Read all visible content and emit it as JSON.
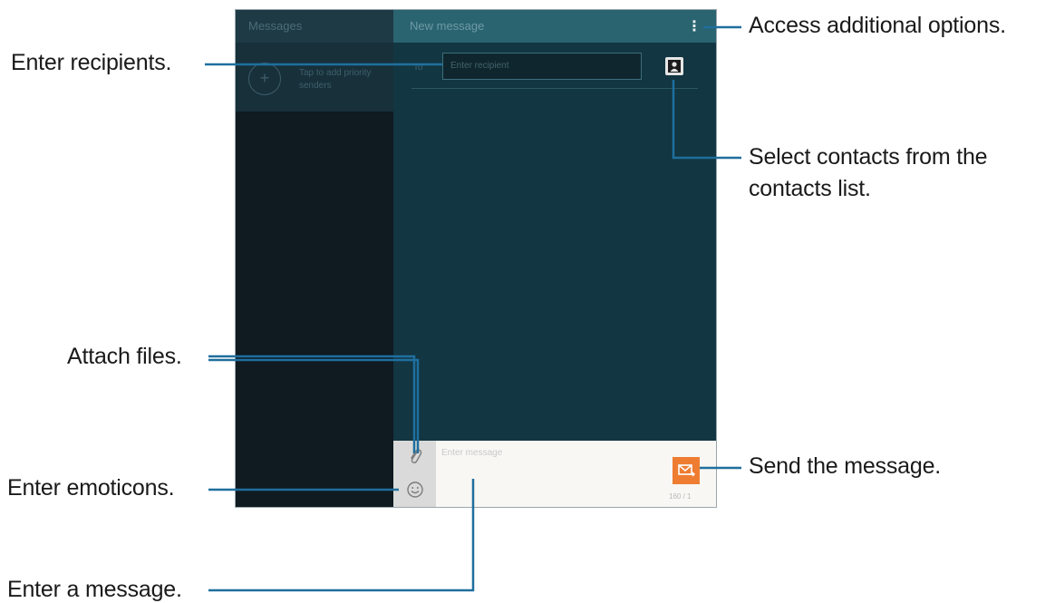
{
  "screen": {
    "left_pane": {
      "title": "Messages",
      "card_text": "Tap to add priority\nsenders"
    },
    "compose": {
      "title": "New message",
      "more_icon": "more-options-icon",
      "recipient_prefix": "To",
      "recipient_placeholder": "Enter recipient",
      "message_placeholder": "Enter message",
      "counter": "160 / 1",
      "send_color": "#ee7d31"
    }
  },
  "callouts": {
    "options": "Access additional options.",
    "recipients": "Enter recipients.",
    "contacts_line1": "Select contacts from the",
    "contacts_line2": "contacts list.",
    "attach": "Attach files.",
    "emoticons": "Enter emoticons.",
    "send": "Send the message.",
    "message": "Enter a message."
  },
  "colors": {
    "callout_line": "#1f6f9e",
    "header": "#2a6470",
    "compose_bg": "#123642"
  }
}
